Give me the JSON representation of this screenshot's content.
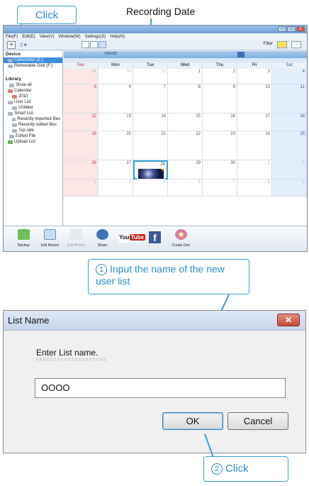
{
  "callouts": {
    "click_top": "Click",
    "recording_date": "Recording Date",
    "input_instruction": "Input the name of the new user list",
    "step1": "1",
    "step2": "2",
    "click_bottom": "Click"
  },
  "app": {
    "menu": [
      "File(F)",
      "Edit(E)",
      "View(V)",
      "Window(W)",
      "Settings(S)",
      "Help(H)"
    ],
    "toolbar": {
      "filter_label": "Filter"
    },
    "sidebar": {
      "device_header": "Device",
      "items_device": [
        "Camcorder (E:)",
        "Removable Disk (F:)"
      ],
      "library_header": "Library",
      "items_library": [
        "Show all",
        "Calendar",
        "2010",
        "User List",
        "Untitled",
        "Smart List",
        "Recently imported files",
        "Recently edited files",
        "Top rate",
        "Edited File",
        "Upload List"
      ]
    },
    "calendar": {
      "month_label": "Month:",
      "days": [
        "Sun",
        "Mon",
        "Tue",
        "Wed",
        "Thu",
        "Fri",
        "Sat"
      ],
      "rows": [
        [
          "31",
          "31",
          "31",
          "1",
          "2",
          "3",
          "4"
        ],
        [
          "5",
          "6",
          "7",
          "8",
          "9",
          "10",
          "11"
        ],
        [
          "12",
          "13",
          "14",
          "15",
          "16",
          "17",
          "18"
        ],
        [
          "19",
          "20",
          "21",
          "22",
          "23",
          "24",
          "25"
        ],
        [
          "26",
          "27",
          "28",
          "29",
          "30",
          "1",
          "2"
        ],
        [
          "3",
          "4",
          "5",
          "6",
          "7",
          "8",
          "9"
        ]
      ]
    },
    "bottom_buttons": [
      "Backup",
      "Edit Movies",
      "Edit Photos",
      "Share",
      "YouTube",
      "Facebook",
      "Create Disc"
    ]
  },
  "dialog": {
    "title": "List Name",
    "close_glyph": "✕",
    "prompt": "Enter List name.",
    "input_value": "OOOO",
    "ok_label": "OK",
    "cancel_label": "Cancel"
  }
}
